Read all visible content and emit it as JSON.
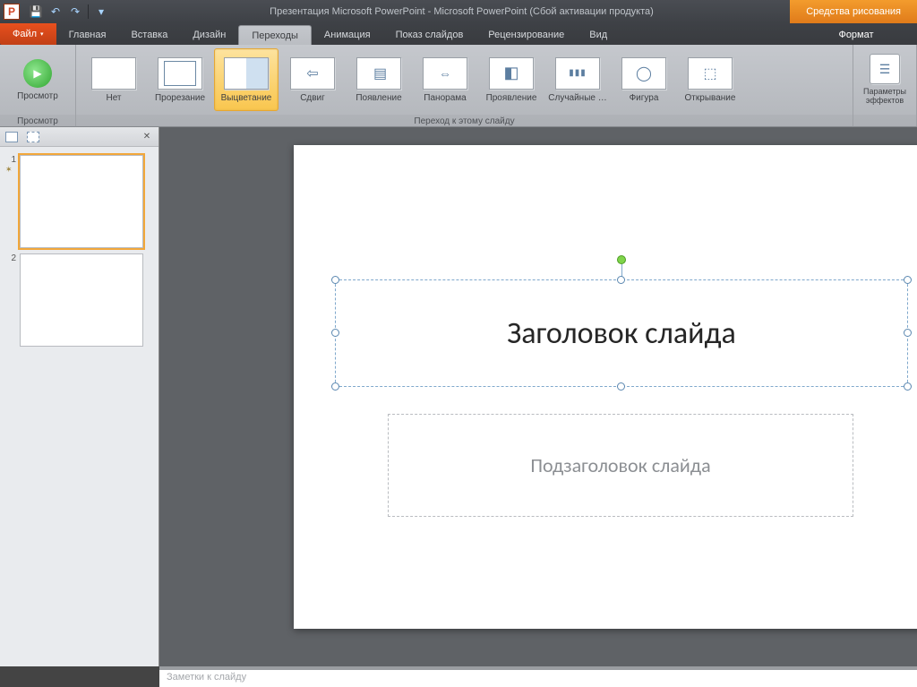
{
  "titlebar": {
    "title": "Презентация Microsoft PowerPoint  -  Microsoft PowerPoint (Сбой активации продукта)",
    "context_tool": "Средства рисования"
  },
  "tabs": {
    "file": "Файл",
    "items": [
      "Главная",
      "Вставка",
      "Дизайн",
      "Переходы",
      "Анимация",
      "Показ слайдов",
      "Рецензирование",
      "Вид"
    ],
    "context": "Формат",
    "active_index": 3
  },
  "ribbon": {
    "preview_group": {
      "label": "Просмотр",
      "button": "Просмотр"
    },
    "transition_group": {
      "label": "Переход к этому слайду",
      "items": [
        "Нет",
        "Прорезание",
        "Выцветание",
        "Сдвиг",
        "Появление",
        "Панорама",
        "Проявление",
        "Случайные …",
        "Фигура",
        "Открывание"
      ],
      "selected_index": 2
    },
    "effects_group": {
      "button": "Параметры эффектов"
    }
  },
  "thumbnails": {
    "slides": [
      {
        "num": "1",
        "starred": true
      },
      {
        "num": "2",
        "starred": false
      }
    ],
    "active_index": 0
  },
  "slide": {
    "title_placeholder": "Заголовок слайда",
    "subtitle_placeholder": "Подзаголовок слайда"
  },
  "notes": {
    "placeholder": "Заметки к слайду"
  }
}
